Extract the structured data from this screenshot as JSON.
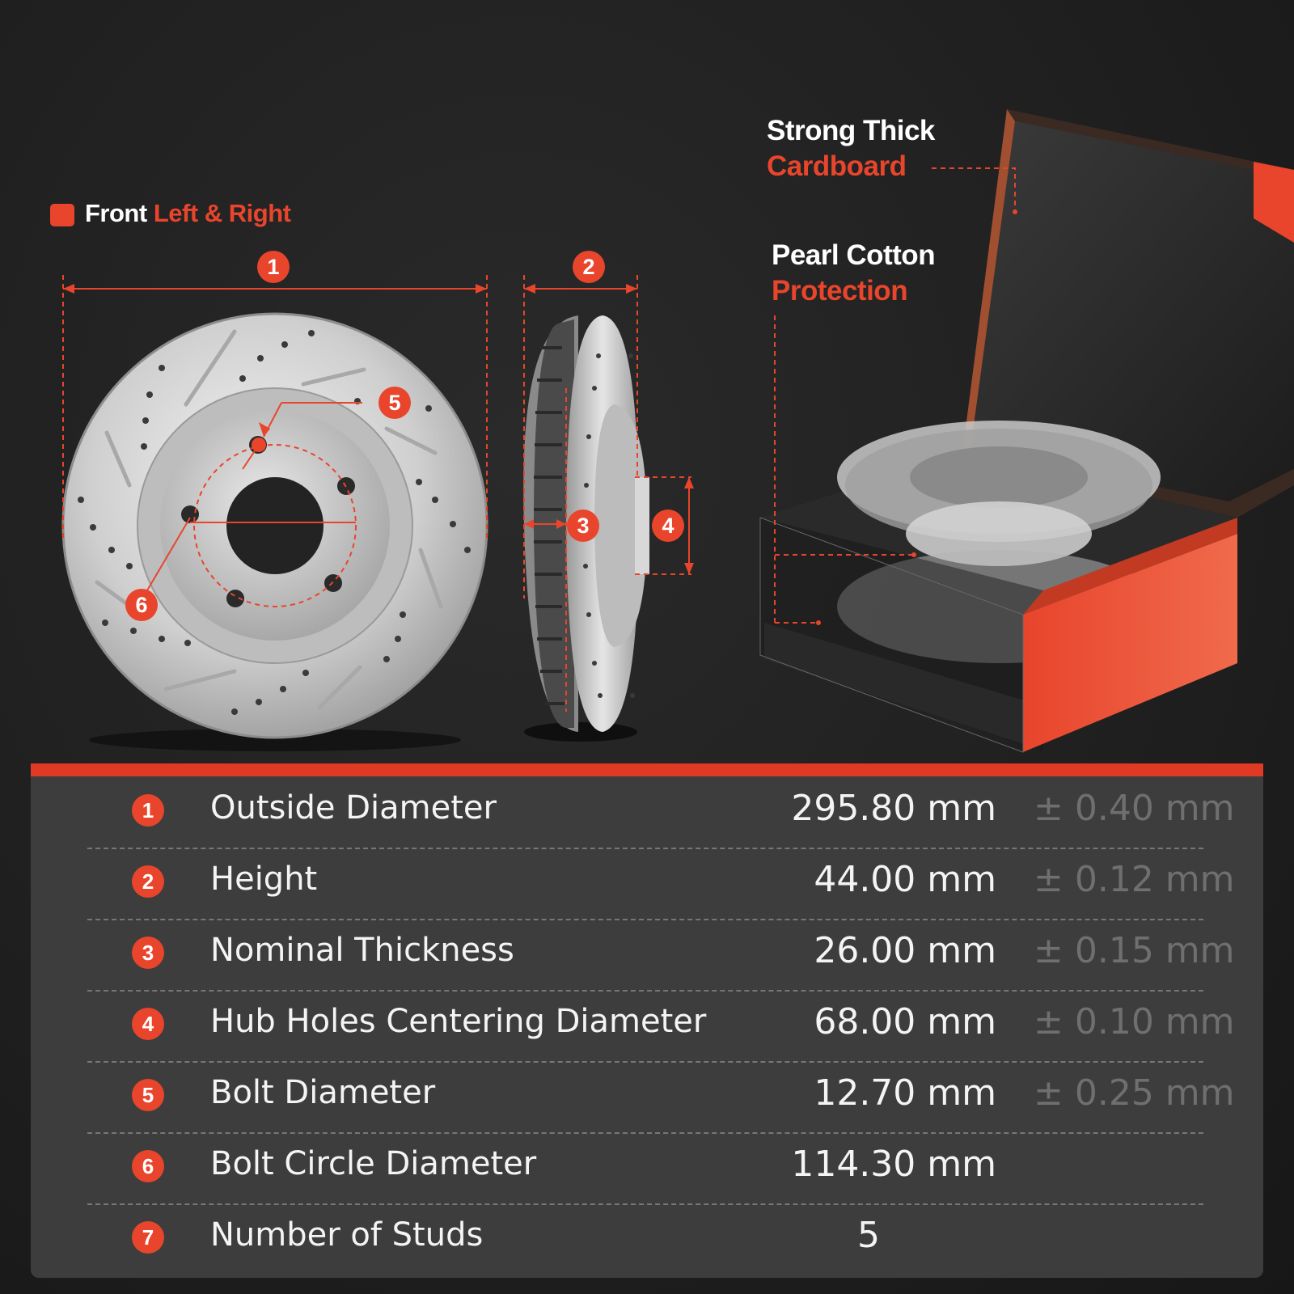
{
  "labels": {
    "front": "Front",
    "left_right": "Left & Right",
    "strong_thick": "Strong Thick",
    "cardboard": "Cardboard",
    "pearl_cotton": "Pearl Cotton",
    "protection": "Protection"
  },
  "badges": [
    "1",
    "2",
    "3",
    "4",
    "5",
    "6"
  ],
  "specs": [
    {
      "num": "1",
      "name": "Outside Diameter",
      "value": "295.80 mm",
      "tolerance": "± 0.40 mm"
    },
    {
      "num": "2",
      "name": "Height",
      "value": "44.00 mm",
      "tolerance": "± 0.12 mm"
    },
    {
      "num": "3",
      "name": "Nominal Thickness",
      "value": "26.00 mm",
      "tolerance": "± 0.15 mm"
    },
    {
      "num": "4",
      "name": "Hub Holes Centering Diameter",
      "value": "68.00 mm",
      "tolerance": "± 0.10 mm"
    },
    {
      "num": "5",
      "name": "Bolt Diameter",
      "value": "12.70 mm",
      "tolerance": "± 0.25 mm"
    },
    {
      "num": "6",
      "name": "Bolt Circle Diameter",
      "value": "114.30 mm",
      "tolerance": ""
    },
    {
      "num": "7",
      "name": "Number of Studs",
      "value": "5",
      "tolerance": ""
    }
  ],
  "colors": {
    "accent": "#e8452c",
    "panel": "#3d3d3d",
    "background": "#202020",
    "tolerance_text": "#6f6f6f"
  }
}
